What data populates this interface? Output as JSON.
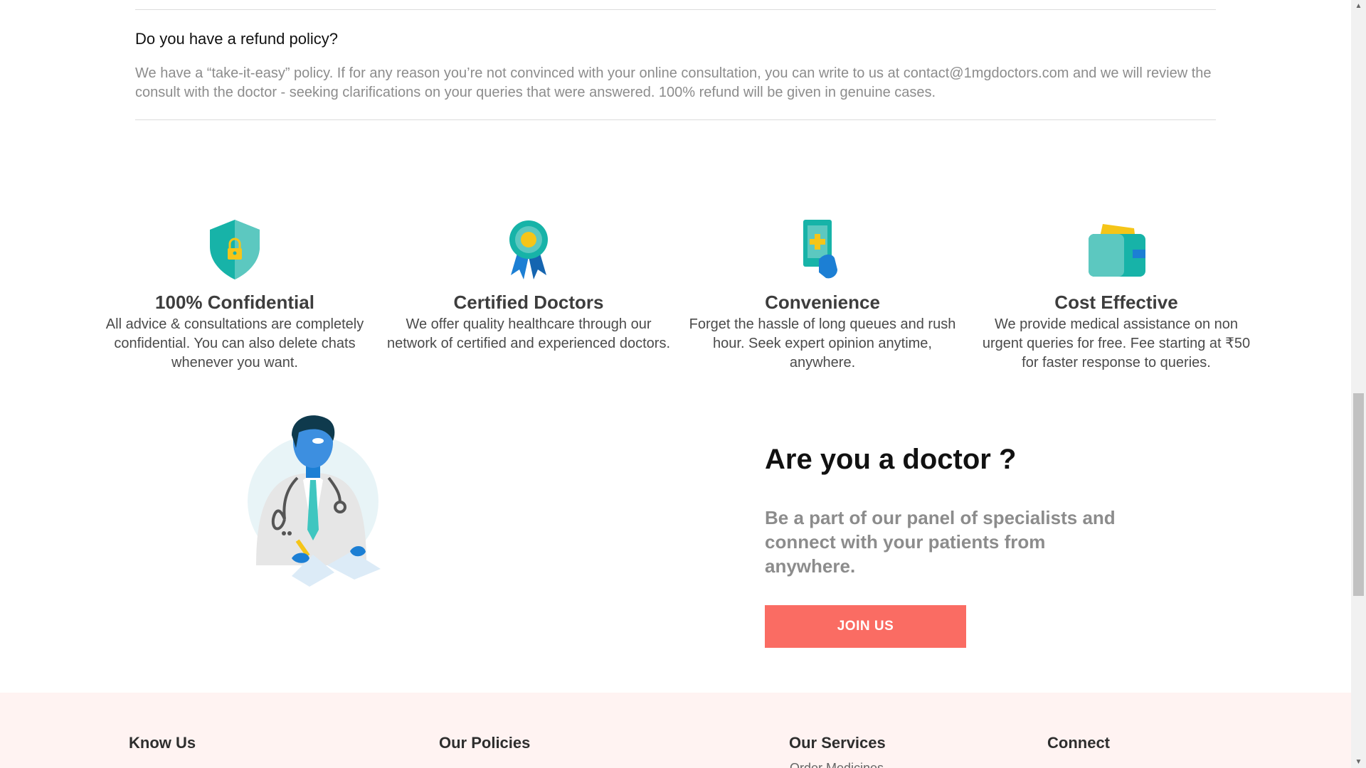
{
  "faq": {
    "question": "Do you have a refund policy?",
    "answer": "We have a “take-it-easy” policy. If for any reason you’re not convinced with your online consultation, you can write to us at contact@1mgdoctors.com and we will review the consult with the doctor - seeking clarifications on your queries that were answered. 100% refund will be given in genuine cases."
  },
  "features": [
    {
      "icon": "shield-lock-icon",
      "title": "100% Confidential",
      "text": "All advice & consultations are completely confidential. You can also delete chats whenever you want."
    },
    {
      "icon": "award-ribbon-icon",
      "title": "Certified Doctors",
      "text": "We offer quality healthcare through our network of certified and experienced doctors."
    },
    {
      "icon": "phone-plus-icon",
      "title": "Convenience",
      "text": "Forget the hassle of long queues and rush hour. Seek expert opinion anytime, anywhere."
    },
    {
      "icon": "wallet-icon",
      "title": "Cost Effective",
      "text": "We provide medical assistance on non urgent queries for free. Fee starting at ₹50 for faster response to queries."
    }
  ],
  "doctor": {
    "title": "Are you a doctor ?",
    "subtitle": "Be a part of our panel of specialists and connect with your patients from anywhere.",
    "join_label": "JOIN US"
  },
  "footer": {
    "headings": [
      "Know Us",
      "Our Policies",
      "Our Services",
      "Connect"
    ],
    "cut_link": "Order Medicines"
  },
  "colors": {
    "accent": "#fa6c63",
    "teal": "#17b3a8",
    "blue": "#1c7fd4",
    "footer_bg": "#fff3f2"
  }
}
